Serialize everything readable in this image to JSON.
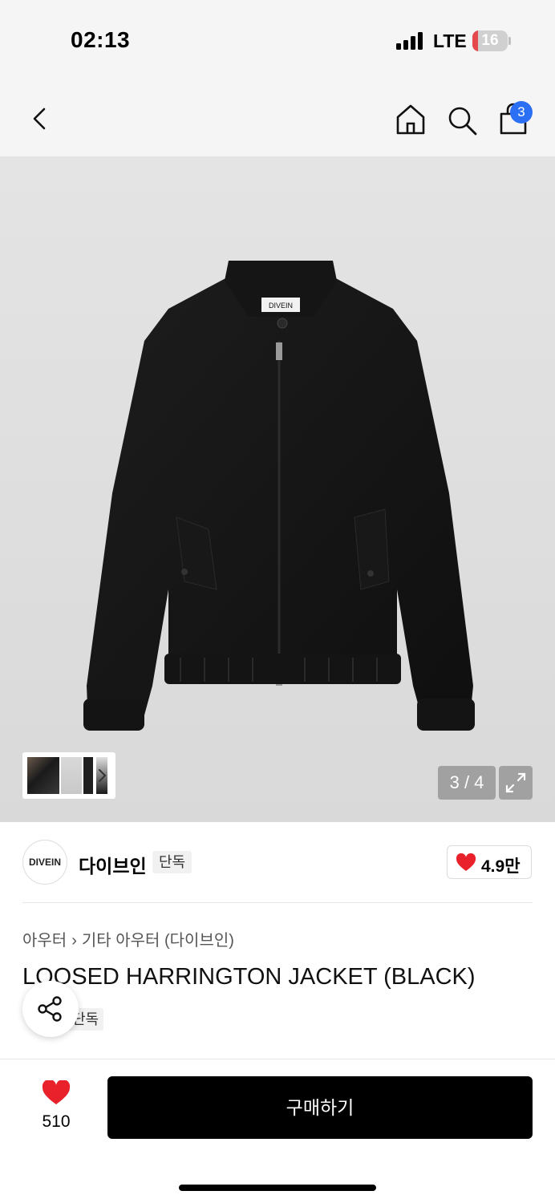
{
  "status_bar": {
    "time": "02:13",
    "network": "LTE",
    "battery": "16",
    "battery_level": 0.16
  },
  "nav": {
    "cart_count": "3"
  },
  "gallery": {
    "counter": "3 / 4",
    "collar_label": "DIVEIN"
  },
  "brand": {
    "logo_text": "DIVEIN",
    "name": "다이브인",
    "tag": "단독",
    "likes": "4.9만"
  },
  "product": {
    "breadcrumb": [
      "아우터",
      "기타 아우터 (다이브인)"
    ],
    "title": "LOOSED HARRINGTON JACKET (BLACK)",
    "tag": "단독"
  },
  "bottom_bar": {
    "wish_count": "510",
    "buy_label": "구매하기"
  },
  "colors": {
    "accent_red": "#e8212b",
    "badge_blue": "#2b6ff5",
    "buy_button": "#000000"
  }
}
